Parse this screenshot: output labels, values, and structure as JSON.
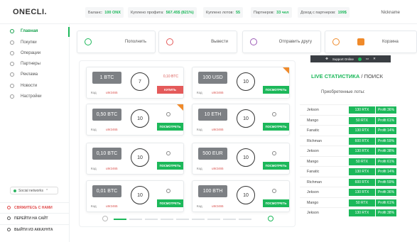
{
  "header": {
    "logo": "ONECLI.",
    "stats": [
      {
        "label": "Баланс:",
        "value": "100 ONX"
      },
      {
        "label": "Куплено профита:",
        "value": "567.45$ (821%)"
      },
      {
        "label": "Куплено лотов:",
        "value": "55"
      },
      {
        "label": "Партнеров:",
        "value": "33 чел"
      },
      {
        "label": "Доход с партнеров:",
        "value": "199$"
      }
    ],
    "nickname": "Nickname"
  },
  "sidebar": {
    "items": [
      {
        "label": "Главная",
        "icon": "home-icon",
        "active": true
      },
      {
        "label": "Покупки",
        "icon": "cart-icon"
      },
      {
        "label": "Операции",
        "icon": "operations-icon"
      },
      {
        "label": "Партнеры",
        "icon": "partners-icon"
      },
      {
        "label": "Реклама",
        "icon": "ads-icon"
      },
      {
        "label": "Новости",
        "icon": "news-icon"
      },
      {
        "label": "Настройки",
        "icon": "settings-icon"
      }
    ],
    "social": "Social networks",
    "contact": "СВЯЖИТЕСЬ С НАМИ",
    "go_site": "ПЕРЕЙТИ НА САЙТ",
    "logout": "ВЫЙТИ ИЗ АККАУНТА"
  },
  "actions": [
    {
      "label": "Пополнить",
      "color": "#1cb85a"
    },
    {
      "label": "Вывести",
      "color": "#e45a5a"
    },
    {
      "label": "Отправить другу",
      "color": "#9b59b6"
    },
    {
      "label": "Корзина",
      "color": "#f08a2a"
    }
  ],
  "lots": [
    {
      "amount": "1 BTC",
      "dial": "7",
      "code_label": "Код",
      "code": "u9r2465",
      "side": "0,10 BTC",
      "button": "КУПИТЬ",
      "sold": true
    },
    {
      "amount": "100 USD",
      "dial": "10",
      "code_label": "Код",
      "code": "u9r2465",
      "button": "ПОСМОТРЕТЬ",
      "hot": true
    },
    {
      "amount": "0,50 BTC",
      "dial": "10",
      "code_label": "Код",
      "code": "u9r2465",
      "button": "ПОСМОТРЕТЬ",
      "hot": true
    },
    {
      "amount": "10 ETH",
      "dial": "10",
      "code_label": "Код",
      "code": "u9r2465",
      "button": "ПОСМОТРЕТЬ"
    },
    {
      "amount": "0,10 BTC",
      "dial": "10",
      "code_label": "Код",
      "code": "u9r2465",
      "button": "ПОСМОТРЕТЬ"
    },
    {
      "amount": "500 EUR",
      "dial": "10",
      "code_label": "Код",
      "code": "u9r2465",
      "button": "ПОСМОТРЕТЬ"
    },
    {
      "amount": "0,01 BTC",
      "dial": "10",
      "code_label": "Код",
      "code": "u9r2465",
      "button": "ПОСМОТРЕТЬ"
    },
    {
      "amount": "100 BTH",
      "dial": "10",
      "code_label": "Код",
      "code": "u9r2465",
      "button": "ПОСМОТРЕТЬ"
    }
  ],
  "support": "Support Online",
  "live": {
    "title": "LIVE СТАТИСТИКА",
    "search": "/ ПОИСК",
    "subtitle": "Приобретенные лоты:"
  },
  "purchases": [
    {
      "name": "Jekson",
      "qty": "130 RTX",
      "profit": "Profit 36%"
    },
    {
      "name": "Mango",
      "qty": "50 RTX",
      "profit": "Profit 61%"
    },
    {
      "name": "Fanatic",
      "qty": "130 RTX",
      "profit": "Profit 14%"
    },
    {
      "name": "Richman",
      "qty": "600 RTX",
      "profit": "Profit 59%"
    },
    {
      "name": "Jekson",
      "qty": "130 RTX",
      "profit": "Profit 38%"
    },
    {
      "name": "Mango",
      "qty": "50 RTX",
      "profit": "Profit 61%"
    },
    {
      "name": "Fanatic",
      "qty": "130 RTX",
      "profit": "Profit 14%"
    },
    {
      "name": "Richman",
      "qty": "600 RTX",
      "profit": "Profit 59%"
    },
    {
      "name": "Jekson",
      "qty": "130 RTX",
      "profit": "Profit 36%"
    },
    {
      "name": "Mango",
      "qty": "50 RTX",
      "profit": "Profit 61%"
    },
    {
      "name": "Jekson",
      "qty": "130 RTX",
      "profit": "Profit 38%"
    }
  ]
}
